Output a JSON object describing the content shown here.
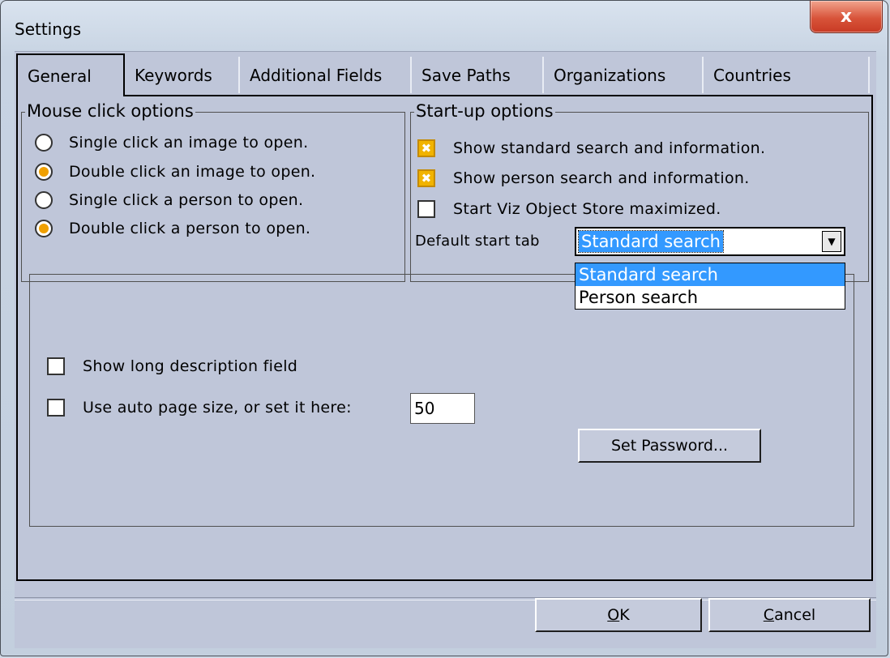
{
  "window": {
    "title": "Settings",
    "close_symbol": "x"
  },
  "tabs": [
    {
      "label": "General",
      "active": true
    },
    {
      "label": "Keywords",
      "active": false
    },
    {
      "label": "Additional Fields",
      "active": false
    },
    {
      "label": "Save Paths",
      "active": false
    },
    {
      "label": "Organizations",
      "active": false
    },
    {
      "label": "Countries",
      "active": false
    }
  ],
  "mouse_group": {
    "legend": "Mouse click options",
    "options": [
      {
        "label": "Single click an image to open.",
        "checked": false
      },
      {
        "label": "Double click an image to open.",
        "checked": true
      },
      {
        "label": "Single click a person to open.",
        "checked": false
      },
      {
        "label": "Double click a person to open.",
        "checked": true
      }
    ]
  },
  "startup_group": {
    "legend": "Start-up options",
    "checks": [
      {
        "label": "Show standard search and information.",
        "checked": true
      },
      {
        "label": "Show person search and information.",
        "checked": true
      },
      {
        "label": "Start Viz Object Store maximized.",
        "checked": false
      }
    ],
    "default_tab_label": "Default start tab",
    "default_tab_value": "Standard search",
    "dropdown_options": [
      "Standard search",
      "Person search"
    ]
  },
  "misc": {
    "long_desc_label": "Show long description field",
    "long_desc_checked": false,
    "auto_page_label": "Use auto page size, or set it here:",
    "auto_page_checked": false,
    "page_size_value": "50",
    "set_password_label": "Set Password..."
  },
  "footer": {
    "ok_mnemonic": "O",
    "ok_rest": "K",
    "cancel_mnemonic": "C",
    "cancel_rest": "ancel"
  },
  "colors": {
    "selection": "#3399ff",
    "check_accent": "#f1b300",
    "panel": "#bfc6d9"
  },
  "icons": {
    "checked_mark": "✖",
    "dropdown_arrow": "▼"
  }
}
